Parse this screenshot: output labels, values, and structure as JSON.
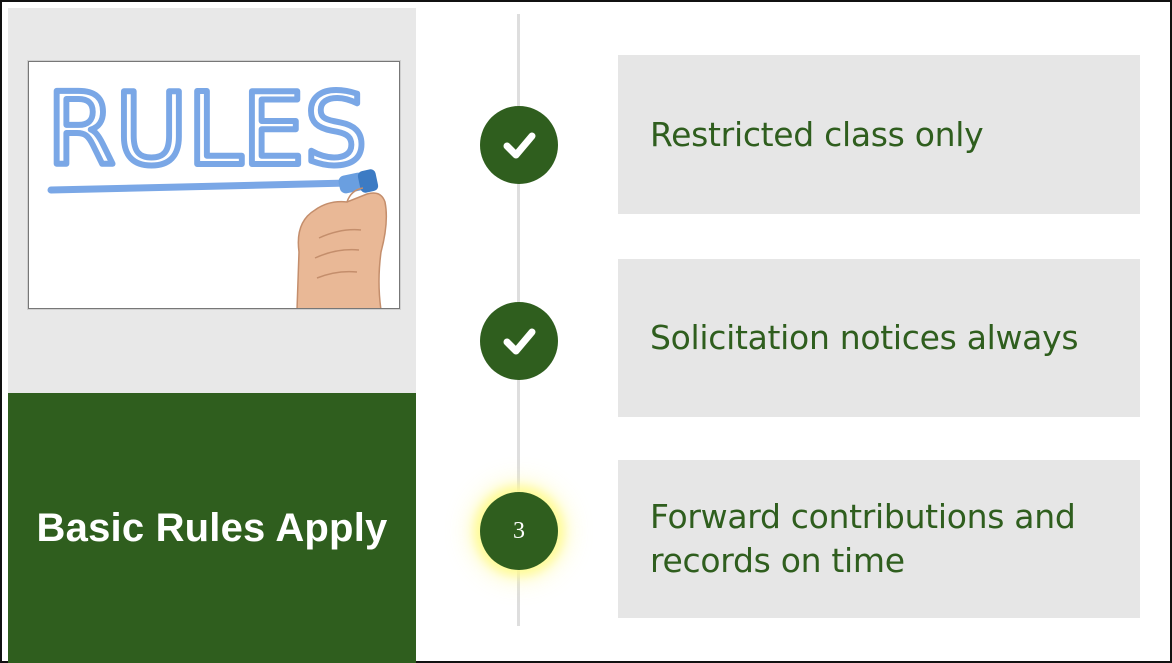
{
  "slide": {
    "title": "Basic Rules Apply",
    "image": {
      "word": "RULES",
      "alt_icon": "hand-writing-rules-illustration"
    },
    "steps": [
      {
        "marker_type": "check",
        "icon": "check-icon",
        "label": "Restricted class only"
      },
      {
        "marker_type": "check",
        "icon": "check-icon",
        "label": "Solicitation notices always"
      },
      {
        "marker_type": "number",
        "number": "3",
        "label": "Forward contributions and records on time"
      }
    ],
    "colors": {
      "accent_green": "#2f5e1e",
      "card_gray": "#e6e6e6",
      "panel_gray": "#e8e8e8",
      "marker_blue": "#7aa7e6",
      "highlight_glow": "#fffa8c"
    }
  }
}
